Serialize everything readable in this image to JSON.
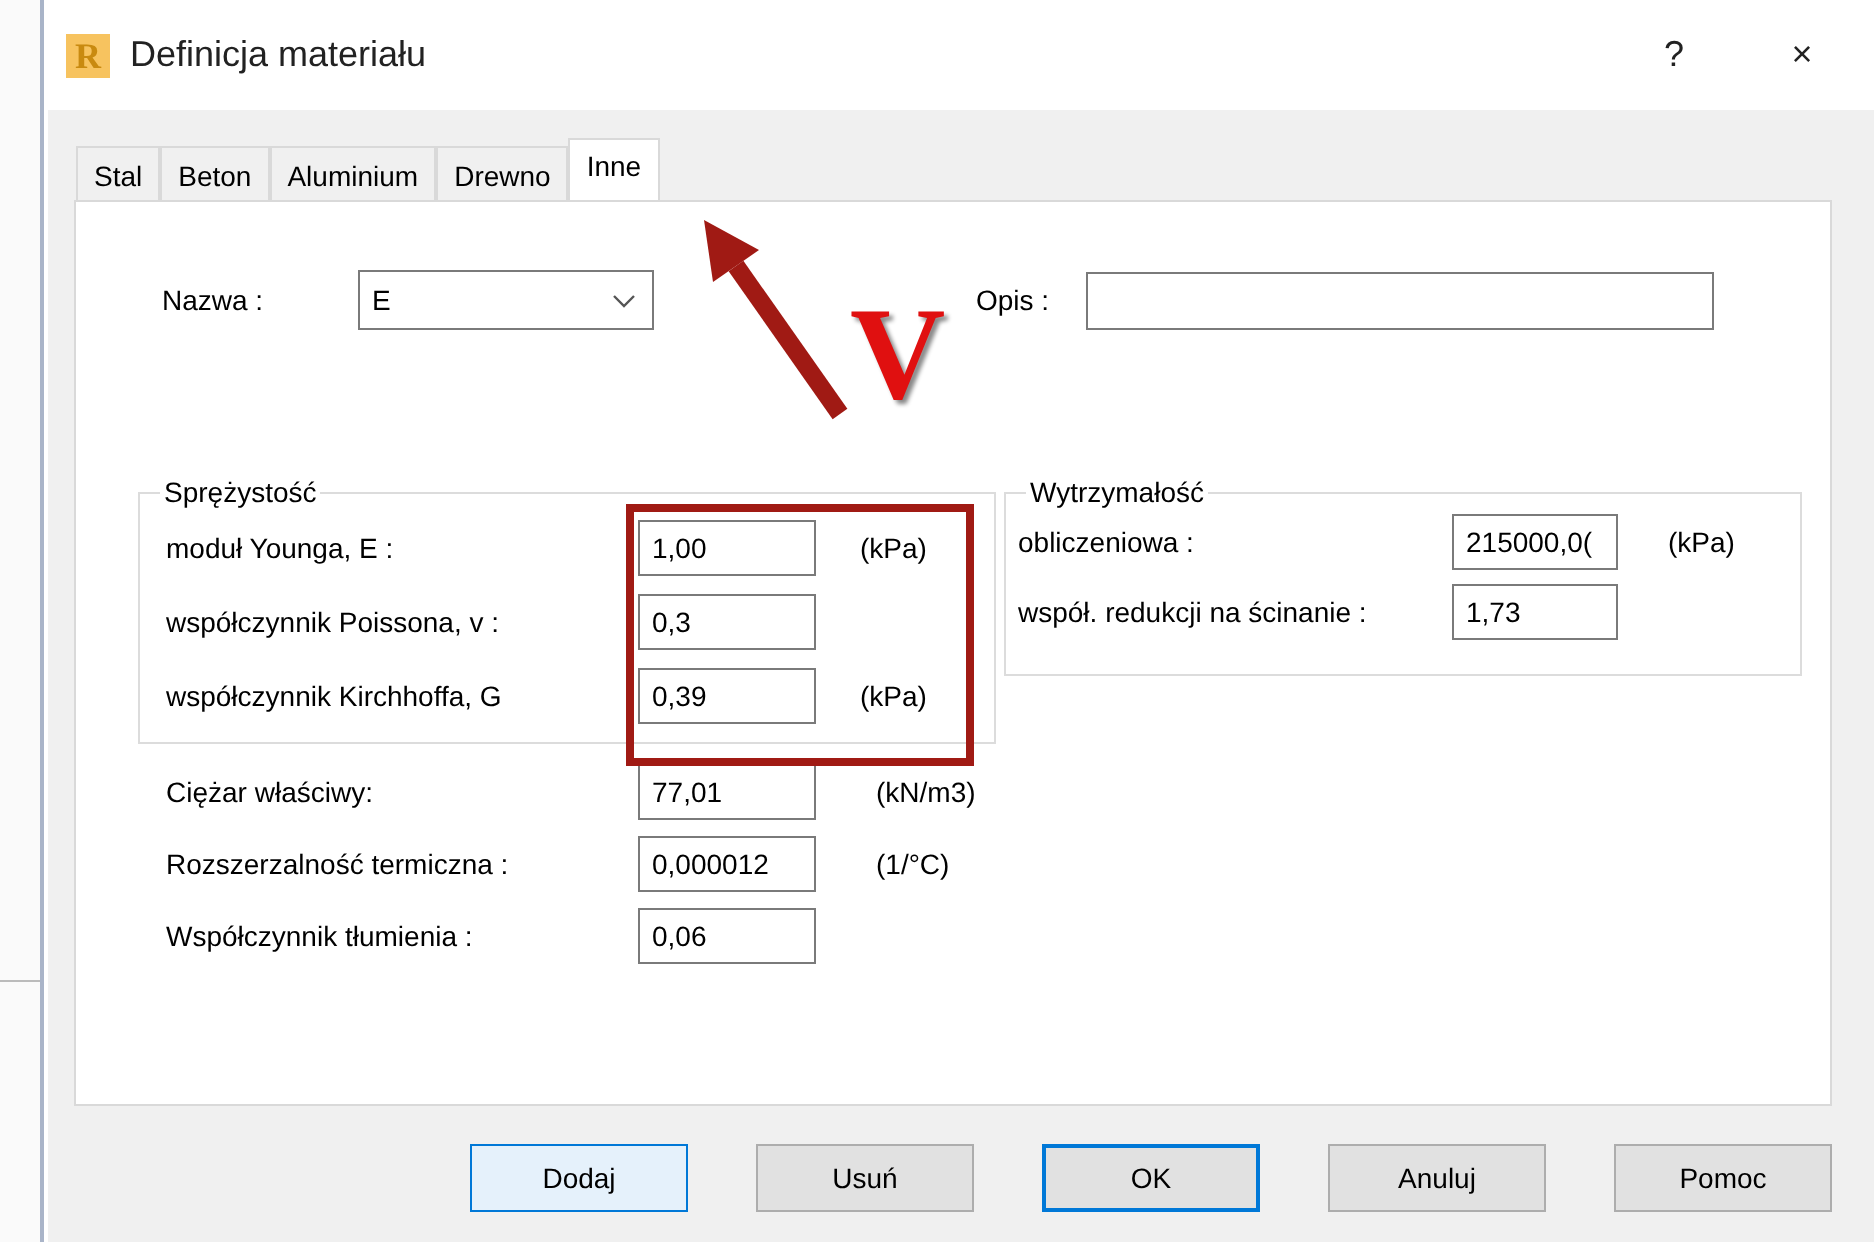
{
  "window": {
    "icon_letter": "R",
    "title": "Definicja materiału",
    "help": "?",
    "close": "×"
  },
  "tabs": [
    {
      "label": "Stal",
      "selected": false
    },
    {
      "label": "Beton",
      "selected": false
    },
    {
      "label": "Aluminium",
      "selected": false
    },
    {
      "label": "Drewno",
      "selected": false
    },
    {
      "label": "Inne",
      "selected": true
    }
  ],
  "name": {
    "label": "Nazwa :",
    "value": "E"
  },
  "description": {
    "label": "Opis :"
  },
  "elasticity": {
    "title": "Sprężystość",
    "fields": [
      {
        "label": "moduł Younga, E :",
        "value": "1,00",
        "unit": "(kPa)"
      },
      {
        "label": "współczynnik Poissona, v :",
        "value": "0,3"
      },
      {
        "label": "współczynnik Kirchhoffa, G",
        "value": "0,39",
        "unit": "(kPa)"
      }
    ]
  },
  "strength": {
    "title": "Wytrzymałość",
    "fields": [
      {
        "label": "obliczeniowa :",
        "value": "215000,0(",
        "unit": "(kPa)"
      },
      {
        "label": "współ. redukcji na ścinanie :",
        "value": "1,73"
      }
    ]
  },
  "properties": [
    {
      "label": "Ciężar właściwy:",
      "value": "77,01",
      "unit": "(kN/m3)"
    },
    {
      "label": "Rozszerzalność termiczna :",
      "value": "0,000012",
      "unit": "(1/°C)"
    },
    {
      "label": "Współczynnik tłumienia :",
      "value": "0,06"
    }
  ],
  "buttons": [
    {
      "label": "Dodaj",
      "hovered": true,
      "default": false
    },
    {
      "label": "Usuń",
      "hovered": false,
      "default": false
    },
    {
      "label": "OK",
      "hovered": false,
      "default": true
    },
    {
      "label": "Anuluj",
      "hovered": false,
      "default": false
    },
    {
      "label": "Pomoc",
      "hovered": false,
      "default": false
    }
  ],
  "annotation": {
    "label": "V"
  }
}
